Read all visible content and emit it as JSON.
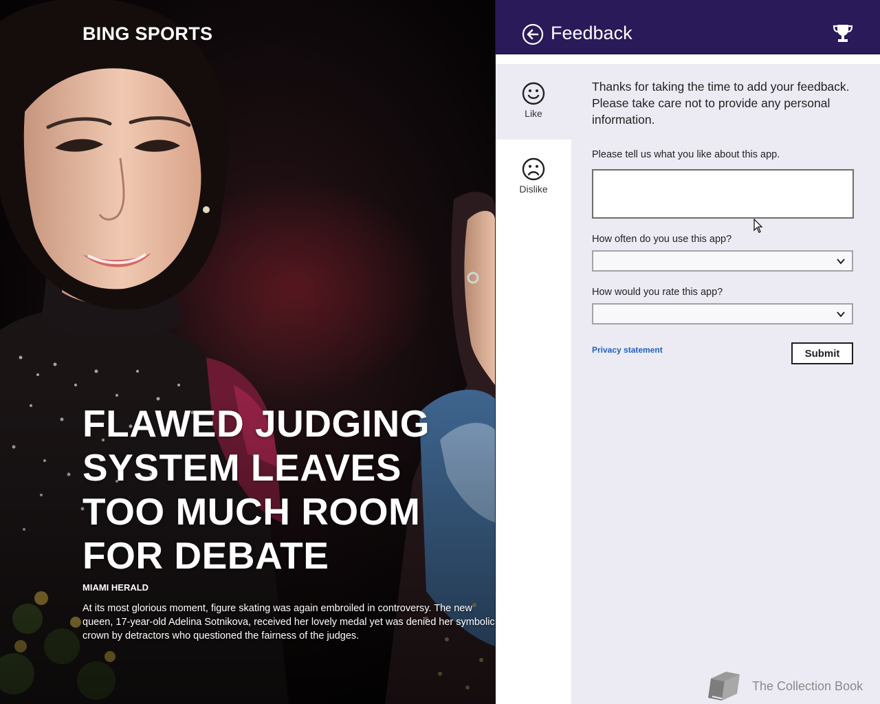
{
  "article": {
    "app_title": "BING SPORTS",
    "headline": "FLAWED JUDGING SYSTEM LEAVES TOO MUCH ROOM FOR DEBATE",
    "source": "MIAMI HERALD",
    "summary": "At its most glorious moment, figure skating was again embroiled in controversy. The new queen, 17-year-old Adelina Sotnikova, received her lovely medal yet was denied her symbolic crown by detractors who questioned the fairness of the judges."
  },
  "feedback": {
    "title": "Feedback",
    "back_icon": "back-arrow-icon",
    "trophy_icon": "trophy-icon",
    "tabs": [
      {
        "label": "Like",
        "icon": "smiley-face-icon",
        "selected": true
      },
      {
        "label": "Dislike",
        "icon": "frown-face-icon",
        "selected": false
      }
    ],
    "intro": "Thanks for taking the time to add your feedback. Please take care not to provide any personal information.",
    "like_question": "Please tell us what you like about this app.",
    "like_answer": "",
    "frequency_question": "How often do you use this app?",
    "frequency_value": "",
    "rating_question": "How would you rate this app?",
    "rating_value": "",
    "privacy_link": "Privacy statement",
    "submit_label": "Submit"
  },
  "watermark": {
    "text": "The Collection Book",
    "icon": "book-icon"
  },
  "colors": {
    "header_bg": "#2a1a59",
    "panel_bg": "#ecebf4",
    "link": "#2060bf"
  }
}
